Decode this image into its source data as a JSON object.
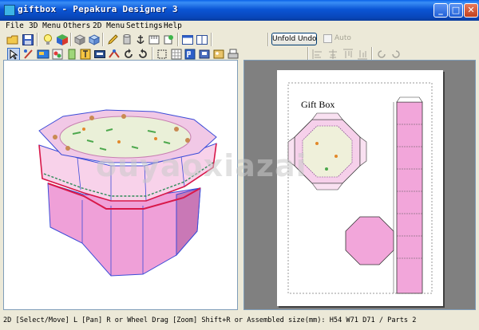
{
  "window": {
    "title": "giftbox - Pepakura Designer 3"
  },
  "menu": [
    "File",
    "3D Menu",
    "Others",
    "2D Menu",
    "Settings",
    "Help"
  ],
  "toolbar": {
    "unfold_label": "Unfold Undo",
    "auto_label": "Auto",
    "auto_checked": false
  },
  "pattern": {
    "title": "Gift Box"
  },
  "status": {
    "text": "2D [Select/Move] L [Pan] R or Wheel Drag [Zoom] Shift+R or Assembled size(mm): H54 W71 D71 / Parts 2"
  },
  "watermark": {
    "text": "ouyaoxiazai"
  },
  "colors": {
    "titlebar": "#0A58D8",
    "chrome": "#ECE9D8",
    "box_pink": "#F0A6DA",
    "cut_line": "#D8184A",
    "fold_line": "#3C4CD8",
    "workspace_gray": "#808080"
  }
}
